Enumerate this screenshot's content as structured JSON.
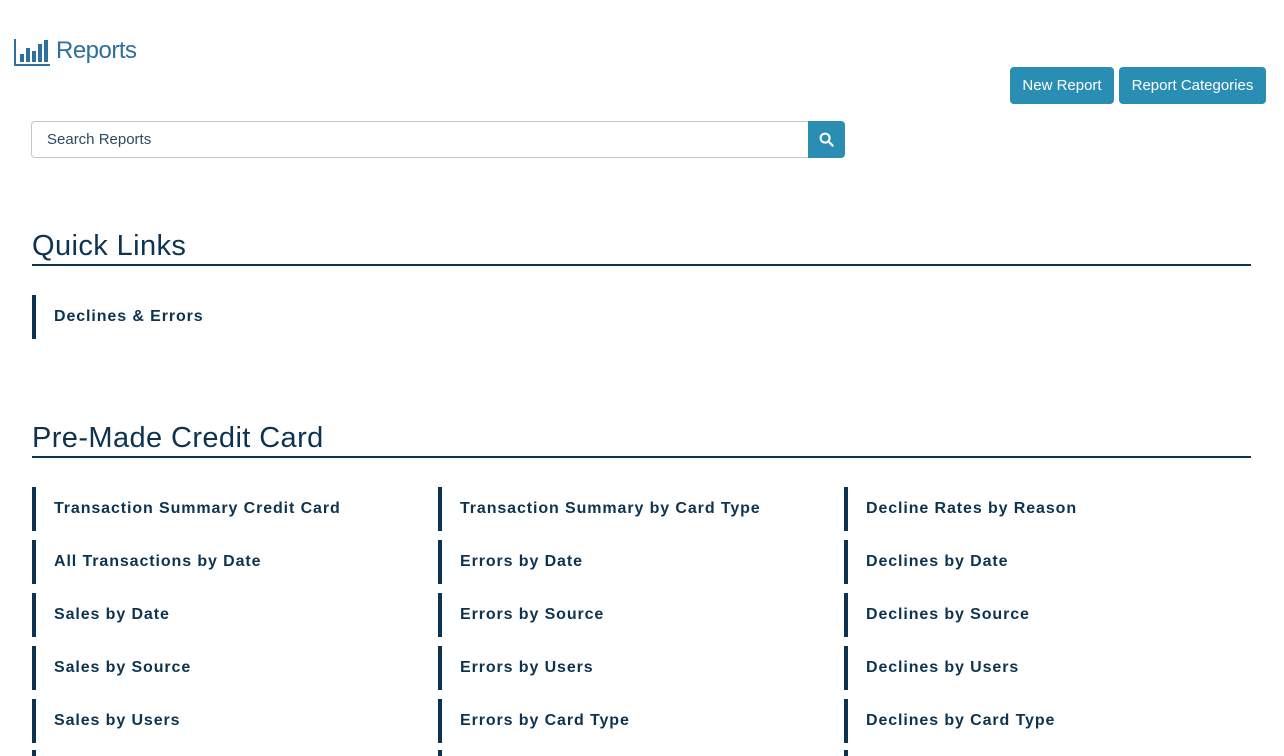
{
  "header": {
    "title": "Reports",
    "icon": "bar-chart-icon"
  },
  "toolbar": {
    "new_report_label": "New Report",
    "report_categories_label": "Report Categories"
  },
  "search": {
    "placeholder": "Search Reports",
    "value": "",
    "button_icon": "search-icon"
  },
  "quick_links": {
    "title": "Quick Links",
    "items": [
      "Declines & Errors"
    ]
  },
  "premade": {
    "title": "Pre-Made Credit Card",
    "columns": [
      [
        "Transaction Summary Credit Card",
        "All Transactions by Date",
        "Sales by Date",
        "Sales by Source",
        "Sales by Users"
      ],
      [
        "Transaction Summary by Card Type",
        "Errors by Date",
        "Errors by Source",
        "Errors by Users",
        "Errors by Card Type"
      ],
      [
        "Decline Rates by Reason",
        "Declines by Date",
        "Declines by Source",
        "Declines by Users",
        "Declines by Card Type"
      ]
    ]
  },
  "colors": {
    "accent": "#2a8db3",
    "navy": "#0d3350",
    "title_blue": "#2e6f9e"
  }
}
